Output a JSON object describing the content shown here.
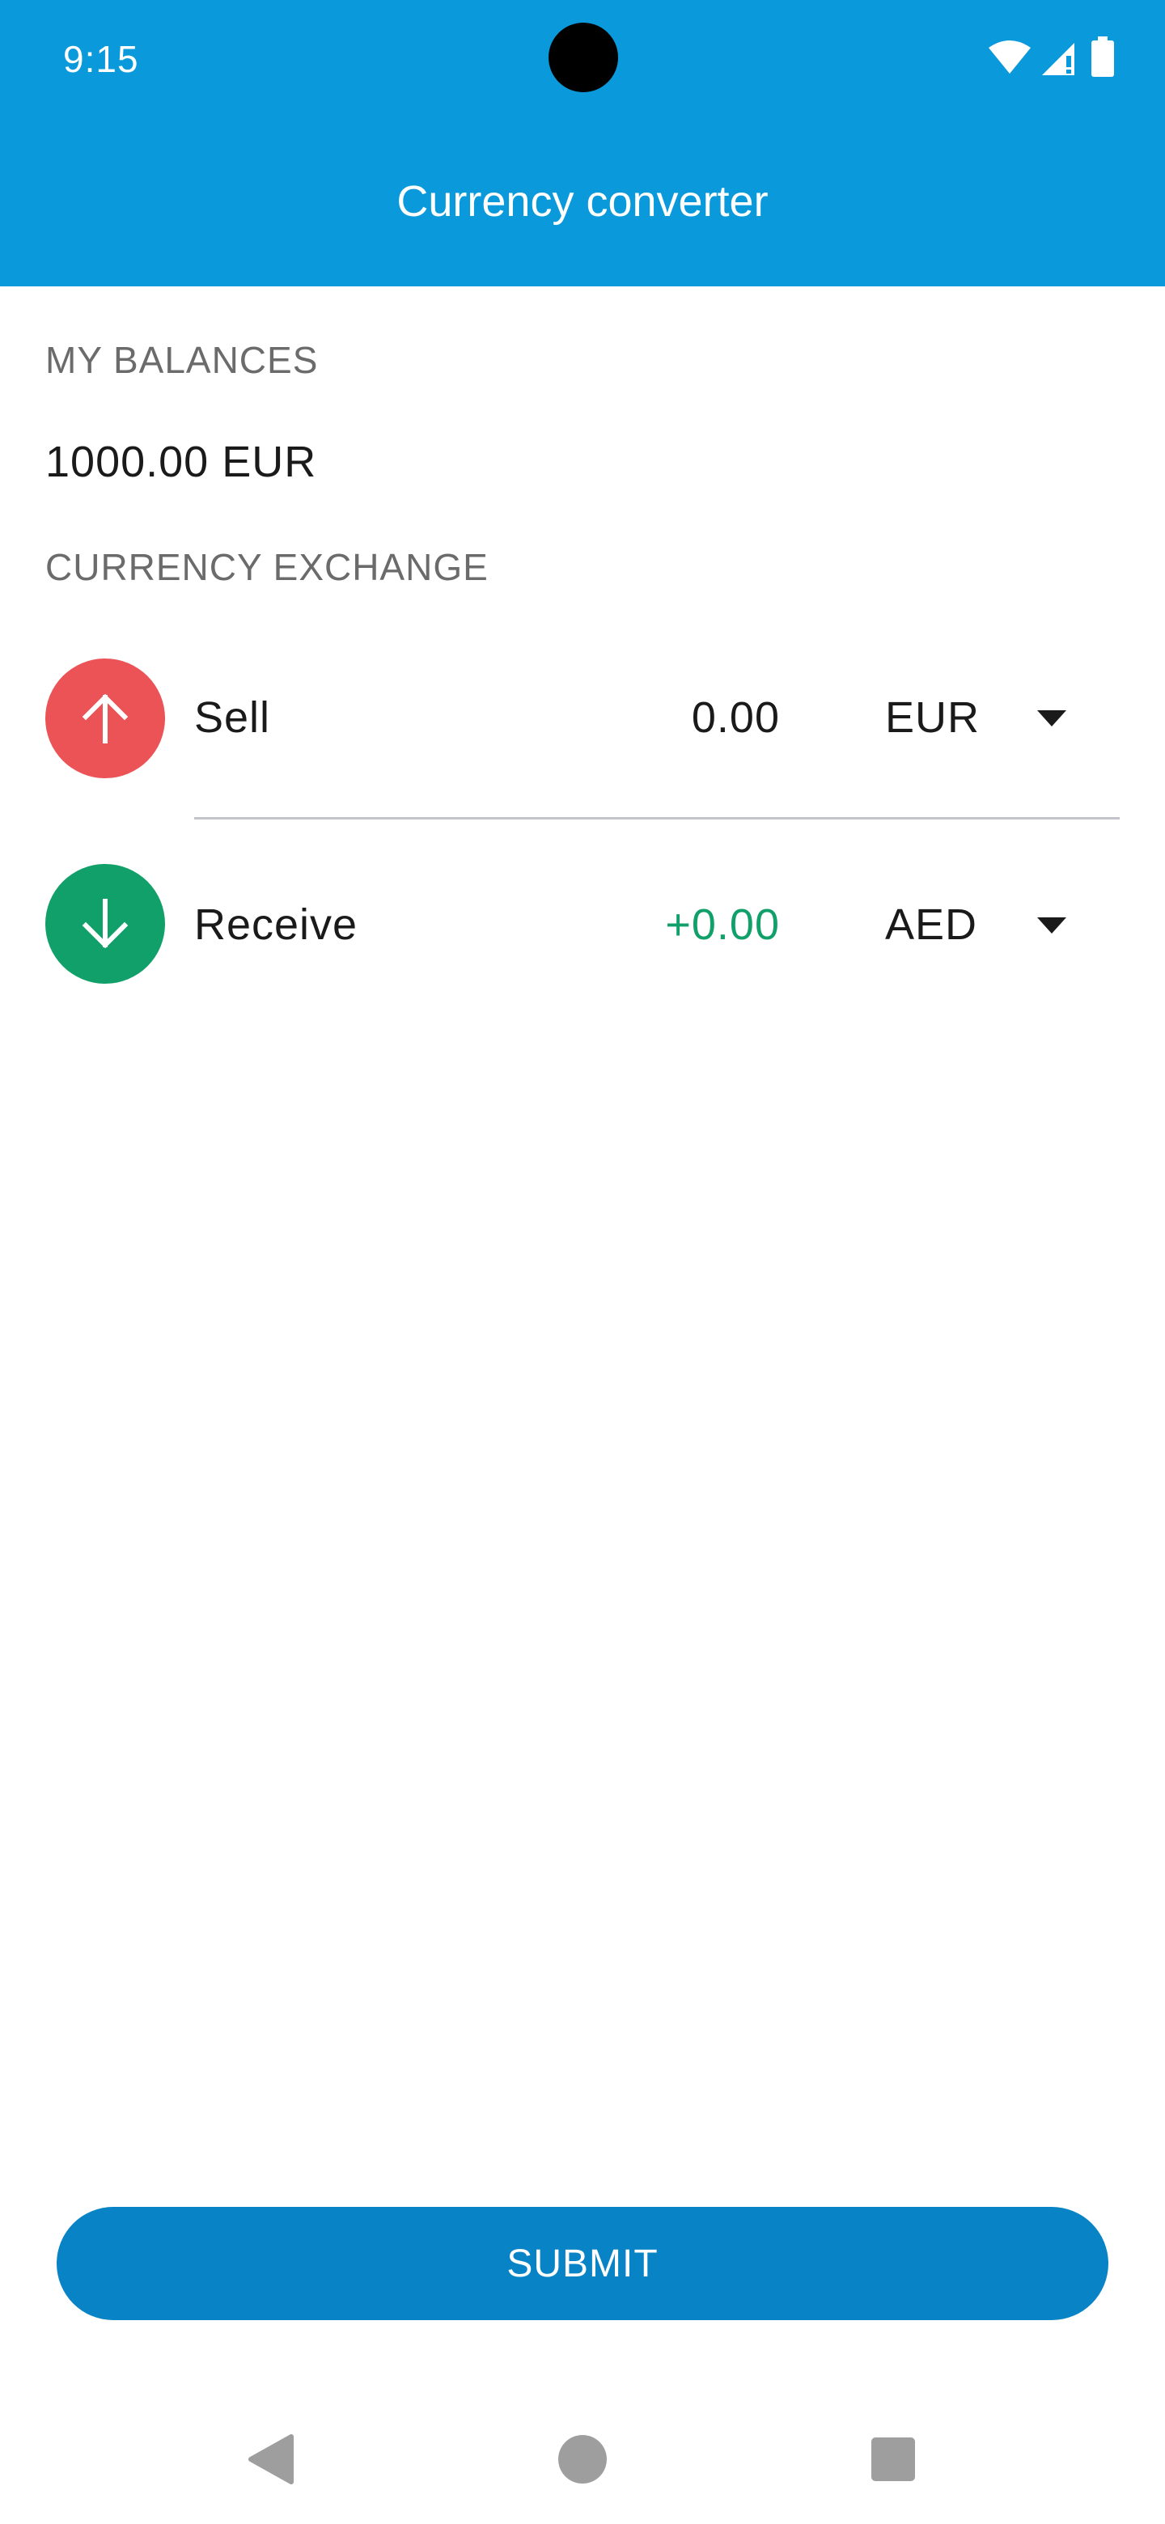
{
  "status_bar": {
    "time": "9:15",
    "icons": [
      "wifi-icon",
      "signal-icon",
      "battery-icon"
    ]
  },
  "app_bar": {
    "title": "Currency converter"
  },
  "balances": {
    "section_label": "MY BALANCES",
    "amount": "1000.00 EUR"
  },
  "exchange": {
    "section_label": "CURRENCY EXCHANGE",
    "sell": {
      "label": "Sell",
      "amount": "0.00",
      "currency": "EUR",
      "icon": "arrow-up-icon"
    },
    "receive": {
      "label": "Receive",
      "amount": "+0.00",
      "currency": "AED",
      "icon": "arrow-down-icon"
    }
  },
  "actions": {
    "submit_label": "SUBMIT"
  },
  "nav": [
    "back-icon",
    "home-icon",
    "recents-icon"
  ],
  "colors": {
    "primary": "#0a9adc",
    "button": "#0884c6",
    "sell": "#ec5356",
    "receive": "#12a06a",
    "receive_amount": "#12a06a"
  }
}
